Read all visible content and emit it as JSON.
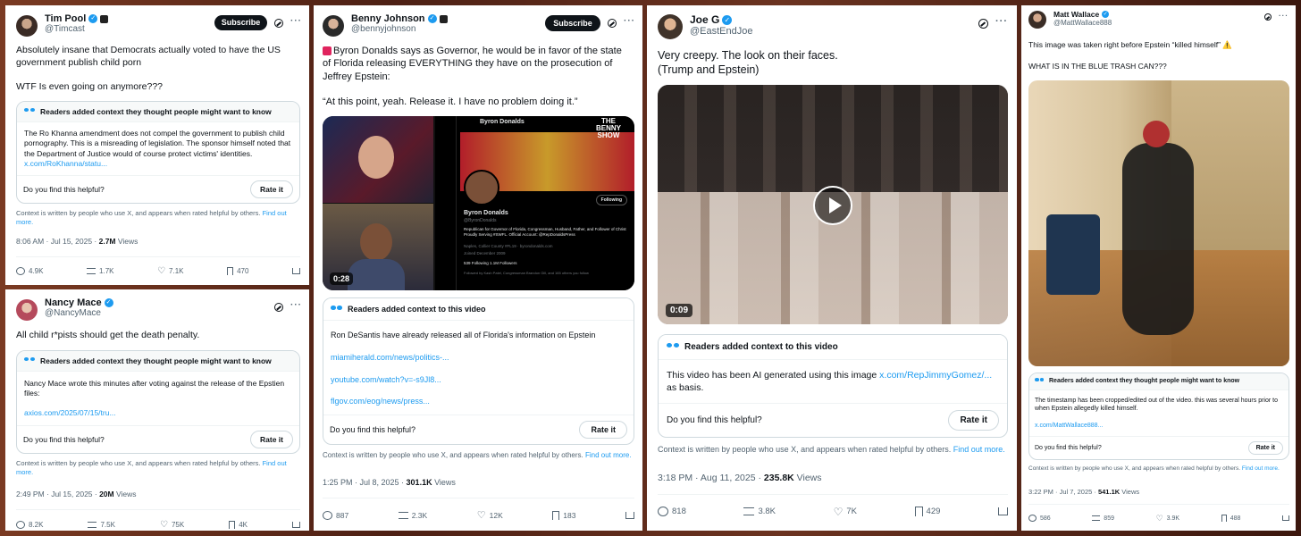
{
  "tweets": [
    {
      "name": "Tim Pool",
      "handle": "@Timcast",
      "subscribe": "Subscribe",
      "text": "Absolutely insane that Democrats actually voted to have the US government publish child porn\n\nWTF Is even going on anymore???",
      "note_header": "Readers added context they thought people might want to know",
      "note_text": "The Ro Khanna amendment does not compel the government to publish child pornography. This is a misreading of legislation. The sponsor himself noted that the Department of Justice would of course protect victims' identities.",
      "note_links": [
        "x.com/RoKhanna/statu..."
      ],
      "helpful": "Do you find this helpful?",
      "rate": "Rate it",
      "ctx": "Context is written by people who use X, and appears when rated helpful by others.",
      "ctx_more": "Find out more.",
      "time": "8:06 AM · Jul 15, 2025 · ",
      "views": "2.7M",
      "views_label": " Views",
      "replies": "4.9K",
      "reposts": "1.7K",
      "likes": "7.1K",
      "bookmarks": "470"
    },
    {
      "name": "Nancy Mace",
      "handle": "@NancyMace",
      "text": "All child r*pists should get the death penalty.",
      "note_header": "Readers added context they thought people might want to know",
      "note_text": "Nancy Mace wrote this minutes after voting against the release of the Epstien files:",
      "note_links": [
        "axios.com/2025/07/15/tru..."
      ],
      "helpful": "Do you find this helpful?",
      "rate": "Rate it",
      "ctx": "Context is written by people who use X, and appears when rated helpful by others.",
      "ctx_more": "Find out more.",
      "time": "2:49 PM · Jul 15, 2025 · ",
      "views": "20M",
      "views_label": " Views",
      "replies": "8.2K",
      "reposts": "7.5K",
      "likes": "75K",
      "bookmarks": "4K"
    },
    {
      "name": "Benny Johnson",
      "handle": "@bennyjohnson",
      "subscribe": "Subscribe",
      "text": "Byron Donalds says as Governor, he would be in favor of the state of Florida releasing EVERYTHING they have on the prosecution of Jeffrey Epstein:\n\n“At this point, yeah. Release it. I have no problem doing it.”",
      "video_duration": "0:28",
      "video_profile_name": "Byron Donalds",
      "video_profile_handle": "@ByronDonalds",
      "video_profile_bio": "Republican for Governor of Florida, Congressman, Husband, Father, and Follower of Christ Proudly Serving #SWFL. Official Account: @RepDonaldsPress",
      "video_profile_loc": "Naples, Collier County #FL19 · byrondonalds.com",
      "video_profile_joined": "Joined December 2009",
      "video_following": "539 Following",
      "video_followers": "1.1M Followers",
      "video_followed_by": "Followed by Kash Patel, Congressman Brandon Gill, and 165 others you follow",
      "video_follow_btn": "Following",
      "video_show_badge": "THE BENNY SHOW",
      "note_header": "Readers added context to this video",
      "note_text": "Ron DeSantis have already released all of Florida's information on Epstein",
      "note_links": [
        "miamiherald.com/news/politics-...",
        "youtube.com/watch?v=-s9Jl8...",
        "flgov.com/eog/news/press..."
      ],
      "helpful": "Do you find this helpful?",
      "rate": "Rate it",
      "ctx": "Context is written by people who use X, and appears when rated helpful by others.",
      "ctx_more": "Find out more.",
      "time": "1:25 PM · Jul 8, 2025 · ",
      "views": "301.1K",
      "views_label": " Views",
      "replies": "887",
      "reposts": "2.3K",
      "likes": "12K",
      "bookmarks": "183"
    },
    {
      "name": "Joe G",
      "handle": "@EastEndJoe",
      "text": "Very creepy. The look on their faces.\n(Trump and Epstein)",
      "video_duration": "0:09",
      "note_header": "Readers added context to this video",
      "note_text": "This video has been AI generated using this image ",
      "note_inline_link": "x.com/RepJimmyGomez/...",
      "note_text_after": "as basis.",
      "helpful": "Do you find this helpful?",
      "rate": "Rate it",
      "ctx": "Context is written by people who use X, and appears when rated helpful by others.",
      "ctx_more": "Find out more.",
      "time": "3:18 PM · Aug 11, 2025 · ",
      "views": "235.8K",
      "views_label": " Views",
      "replies": "818",
      "reposts": "3.8K",
      "likes": "7K",
      "bookmarks": "429"
    },
    {
      "name": "Matt Wallace",
      "handle": "@MattWallace888",
      "text": "This image was taken right before Epstein “killed himself” ⚠️\n\nWHAT IS IN THE BLUE TRASH CAN???",
      "note_header": "Readers added context they thought people might want to know",
      "note_text": "The timestamp has been cropped/edited out of the video. this was several hours prior to when Epstein allegedly killed himself.",
      "note_links": [
        "x.com/MattWallace888..."
      ],
      "helpful": "Do you find this helpful?",
      "rate": "Rate it",
      "ctx": "Context is written by people who use X, and appears when rated helpful by others.",
      "ctx_more": "Find out more.",
      "time": "3:22 PM · Jul 7, 2025 · ",
      "views": "541.1K",
      "views_label": " Views",
      "replies": "586",
      "reposts": "859",
      "likes": "3.9K",
      "bookmarks": "488"
    }
  ],
  "colors": {
    "link": "#1d9bf0",
    "text": "#0f1419",
    "muted": "#536471",
    "border": "#cfd9de"
  },
  "icons": [
    "verified-badge-icon",
    "grok-icon",
    "more-icon",
    "community-notes-icon",
    "reply-icon",
    "repost-icon",
    "like-icon",
    "bookmark-icon",
    "share-icon",
    "play-icon",
    "siren-icon"
  ]
}
